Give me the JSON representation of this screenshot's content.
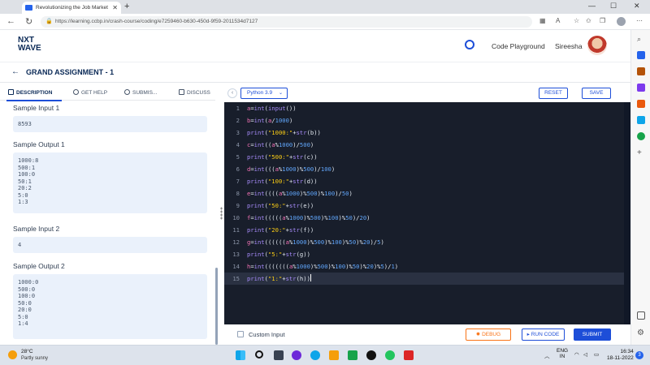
{
  "browser": {
    "tab_title": "Revolutionizing the Job Market |",
    "new_tab": "+",
    "url_host": "https://learning.ccbp.in",
    "url_path": "/crash-course/coding/e7259460-b630-450d-9f59-2011534d7127"
  },
  "header": {
    "logo_line1": "NXT",
    "logo_line2": "WAVE",
    "playground_label": "Code Playground",
    "user_name": "Sireesha"
  },
  "assignment": {
    "title": "GRAND ASSIGNMENT - 1"
  },
  "left_tabs": {
    "description": "DESCRIPTION",
    "get_help": "GET HELP",
    "submissions": "SUBMIS...",
    "discuss": "DISCUSS"
  },
  "samples": [
    {
      "label": "Sample Input 1",
      "value": "8593"
    },
    {
      "label": "Sample Output 1",
      "value": "1000:8\n500:1\n100:0\n50:1\n20:2\n5:0\n1:3"
    },
    {
      "label": "Sample Input 2",
      "value": "4"
    },
    {
      "label": "Sample Output 2",
      "value": "1000:0\n500:0\n100:0\n50:0\n20:0\n5:0\n1:4"
    }
  ],
  "editor": {
    "language": "Python 3.9",
    "reset_label": "RESET",
    "save_label": "SAVE",
    "current_line": 15
  },
  "actions": {
    "custom_input_label": "Custom Input",
    "debug_label": "DEBUG",
    "run_label": "RUN CODE",
    "submit_label": "SUBMIT"
  },
  "taskbar": {
    "temperature": "28°C",
    "weather": "Partly sunny",
    "lang_line1": "ENG",
    "lang_line2": "IN",
    "time": "16:34",
    "date": "18-11-2022",
    "notifications": "3"
  },
  "colors": {
    "accent": "#1d4ed8",
    "editor_bg": "#181e2b",
    "debug": "#f97316",
    "sample_box": "#eaf1fb"
  }
}
